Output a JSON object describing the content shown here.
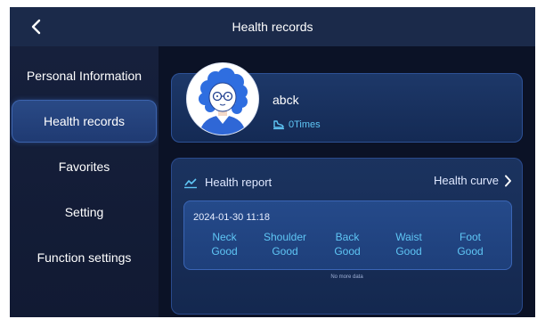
{
  "header": {
    "title": "Health records",
    "back_icon": "chevron-left-icon"
  },
  "sidebar": {
    "items": [
      {
        "label": "Personal Information",
        "active": false
      },
      {
        "label": "Health records",
        "active": true
      },
      {
        "label": "Favorites",
        "active": false
      },
      {
        "label": "Setting",
        "active": false
      },
      {
        "label": "Function settings",
        "active": false
      }
    ]
  },
  "profile": {
    "username": "abck",
    "times": "0Times",
    "times_icon": "shoe-icon",
    "avatar": "avatar-icon"
  },
  "report": {
    "title": "Health report",
    "title_icon": "line-chart-icon",
    "curve_label": "Health curve",
    "curve_icon": "chevron-right-icon",
    "records": [
      {
        "date": "2024-01-30 11:18",
        "metrics": [
          {
            "name": "Neck",
            "value": "Good"
          },
          {
            "name": "Shoulder",
            "value": "Good"
          },
          {
            "name": "Back",
            "value": "Good"
          },
          {
            "name": "Waist",
            "value": "Good"
          },
          {
            "name": "Foot",
            "value": "Good"
          }
        ]
      }
    ],
    "no_more": "No more data"
  },
  "colors": {
    "accent": "#5fc6f5",
    "header_bg": "#1b2a4a",
    "app_bg": "#0a1024",
    "active_item": "#2a4a86"
  }
}
